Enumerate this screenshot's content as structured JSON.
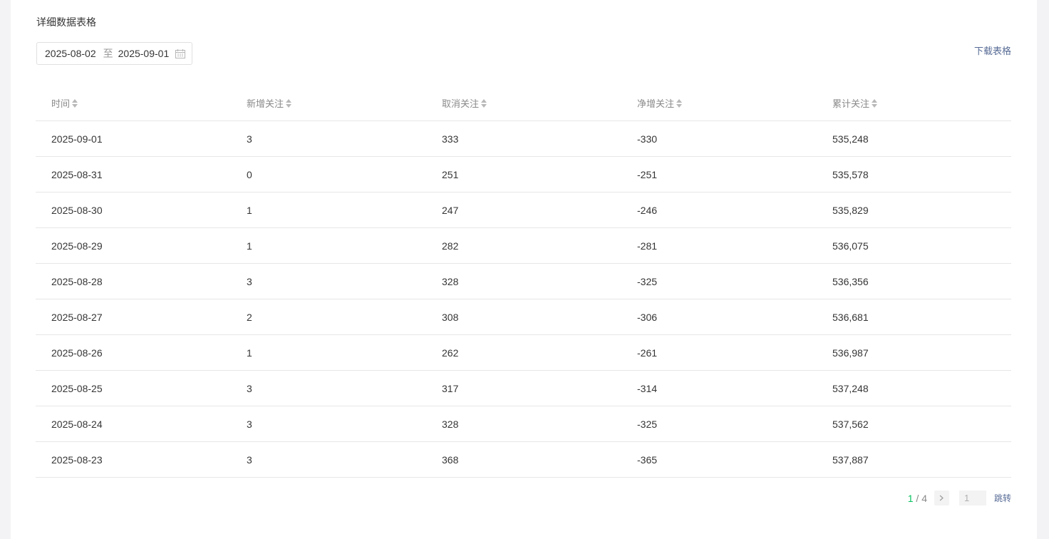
{
  "section": {
    "title": "详细数据表格",
    "download_label": "下载表格"
  },
  "date_range": {
    "start": "2025-08-02",
    "separator": "至",
    "end": "2025-09-01"
  },
  "table": {
    "headers": [
      "时间",
      "新增关注",
      "取消关注",
      "净增关注",
      "累计关注"
    ],
    "rows": [
      [
        "2025-09-01",
        "3",
        "333",
        "-330",
        "535,248"
      ],
      [
        "2025-08-31",
        "0",
        "251",
        "-251",
        "535,578"
      ],
      [
        "2025-08-30",
        "1",
        "247",
        "-246",
        "535,829"
      ],
      [
        "2025-08-29",
        "1",
        "282",
        "-281",
        "536,075"
      ],
      [
        "2025-08-28",
        "3",
        "328",
        "-325",
        "536,356"
      ],
      [
        "2025-08-27",
        "2",
        "308",
        "-306",
        "536,681"
      ],
      [
        "2025-08-26",
        "1",
        "262",
        "-261",
        "536,987"
      ],
      [
        "2025-08-25",
        "3",
        "317",
        "-314",
        "537,248"
      ],
      [
        "2025-08-24",
        "3",
        "328",
        "-325",
        "537,562"
      ],
      [
        "2025-08-23",
        "3",
        "368",
        "-365",
        "537,887"
      ]
    ]
  },
  "pagination": {
    "current": "1",
    "divider": " / ",
    "total": "4",
    "input_value": "1",
    "jump_label": "跳转"
  },
  "colors": {
    "accent_green": "#07c160",
    "link_blue": "#576b95"
  },
  "icons": {
    "calendar": "calendar-icon",
    "next": "chevron-right-icon",
    "sort": "sort-caret-icon"
  }
}
